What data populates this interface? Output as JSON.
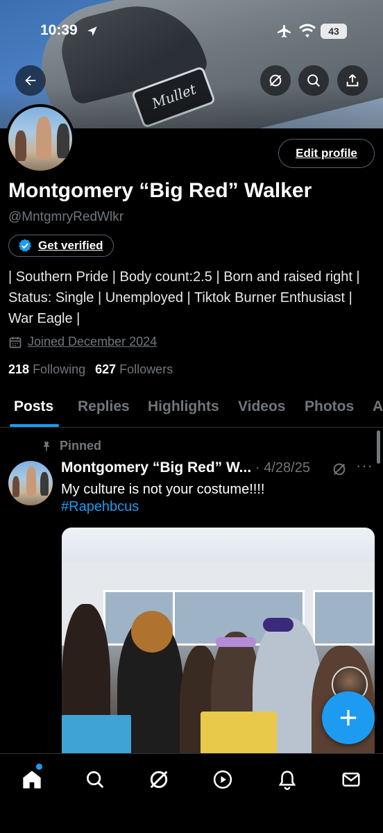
{
  "status_bar": {
    "time": "10:39",
    "battery": "43"
  },
  "profile": {
    "display_name": "Montgomery “Big Red” Walker",
    "handle": "@MntgmryRedWlkr",
    "edit_profile_label": "Edit profile",
    "get_verified_label": "Get verified",
    "bio": "| Southern Pride | Body count:2.5 | Born and raised right | Status: Single | Unemployed | Tiktok Burner Enthusiast | War Eagle |",
    "joined": "Joined December 2024",
    "following_count": "218",
    "following_label": "Following",
    "followers_count": "627",
    "followers_label": "Followers",
    "banner_decal_text": "Mullet"
  },
  "tabs": [
    {
      "label": "Posts",
      "active": true
    },
    {
      "label": "Replies",
      "active": false
    },
    {
      "label": "Highlights",
      "active": false
    },
    {
      "label": "Videos",
      "active": false
    },
    {
      "label": "Photos",
      "active": false
    },
    {
      "label": "A",
      "active": false
    }
  ],
  "tweet": {
    "pinned_label": "Pinned",
    "author": "Montgomery “Big Red” W...",
    "date": "· 4/28/25",
    "more": "···",
    "text": "My culture is not your costume!!!!",
    "hashtag": "#Rapehbcus"
  },
  "icons": {
    "back": "back-arrow-icon",
    "grok": "grok-icon",
    "search": "search-icon",
    "share": "share-icon",
    "calendar": "calendar-icon",
    "pin": "pin-icon",
    "verified": "verified-badge-icon",
    "compose": "plus-icon",
    "nav": [
      "home-icon",
      "search-icon",
      "grok-icon",
      "video-icon",
      "bell-icon",
      "mail-icon"
    ]
  },
  "colors": {
    "accent": "#1d9bf0",
    "background": "#000000",
    "muted": "#71767b",
    "text": "#e7e9ea"
  }
}
